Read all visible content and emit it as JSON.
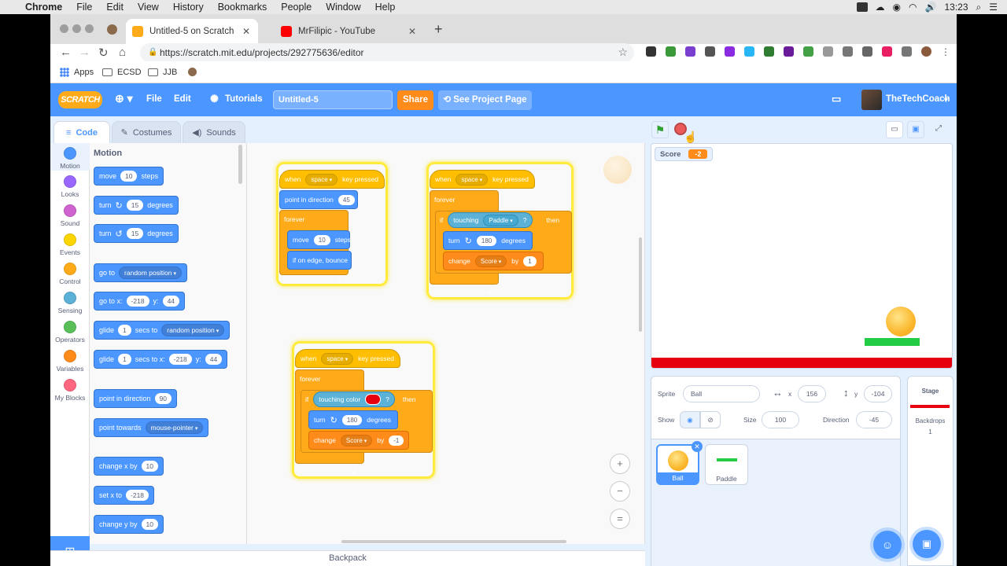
{
  "macos": {
    "app": "Chrome",
    "menu": [
      "File",
      "Edit",
      "View",
      "History",
      "Bookmarks",
      "People",
      "Window",
      "Help"
    ],
    "time": "13:23"
  },
  "browser": {
    "tabs": [
      {
        "title": "Untitled-5 on Scratch",
        "active": true
      },
      {
        "title": "MrFilipic - YouTube",
        "active": false
      }
    ],
    "url": "https://scratch.mit.edu/projects/292775636/editor",
    "bookmarks": [
      "Apps",
      "ECSD",
      "JJB"
    ]
  },
  "scratch": {
    "logo": "SCRATCH",
    "menu": {
      "file": "File",
      "edit": "Edit",
      "tutorials": "Tutorials"
    },
    "project_title": "Untitled-5",
    "share": "Share",
    "see_project": "See Project Page",
    "username": "TheTechCoach",
    "editor_tabs": [
      "Code",
      "Costumes",
      "Sounds"
    ],
    "categories": [
      {
        "label": "Motion",
        "color": "#4c97ff"
      },
      {
        "label": "Looks",
        "color": "#9966ff"
      },
      {
        "label": "Sound",
        "color": "#cf63cf"
      },
      {
        "label": "Events",
        "color": "#ffd500"
      },
      {
        "label": "Control",
        "color": "#ffab19"
      },
      {
        "label": "Sensing",
        "color": "#5cb1d6"
      },
      {
        "label": "Operators",
        "color": "#59c059"
      },
      {
        "label": "Variables",
        "color": "#ff8c1a"
      },
      {
        "label": "My Blocks",
        "color": "#ff6680"
      }
    ],
    "palette": {
      "heading": "Motion",
      "move": {
        "a": "move",
        "n": "10",
        "b": "steps"
      },
      "turn_cw": {
        "a": "turn",
        "n": "15",
        "b": "degrees"
      },
      "turn_ccw": {
        "a": "turn",
        "n": "15",
        "b": "degrees"
      },
      "goto": {
        "a": "go to",
        "d": "random position"
      },
      "gotoxy": {
        "a": "go to x:",
        "x": "-218",
        "b": "y:",
        "y": "44"
      },
      "glide_to": {
        "a": "glide",
        "n": "1",
        "b": "secs to",
        "d": "random position"
      },
      "glide_xy": {
        "a": "glide",
        "n": "1",
        "b": "secs to x:",
        "x": "-218",
        "c": "y:",
        "y": "44"
      },
      "point_dir": {
        "a": "point in direction",
        "n": "90"
      },
      "point_towards": {
        "a": "point towards",
        "d": "mouse-pointer"
      },
      "change_x": {
        "a": "change x by",
        "n": "10"
      },
      "set_x": {
        "a": "set x to",
        "n": "-218"
      },
      "change_y": {
        "a": "change y by",
        "n": "10"
      }
    },
    "scripts": {
      "s1": {
        "when": "when",
        "key": "space",
        "pressed": "key pressed",
        "point": "point in direction",
        "point_n": "45",
        "forever": "forever",
        "move": "move",
        "move_n": "10",
        "steps": "steps",
        "bounce": "if on edge, bounce"
      },
      "s2": {
        "when": "when",
        "key": "space",
        "pressed": "key pressed",
        "forever": "forever",
        "if": "if",
        "touching": "touching",
        "target": "Paddle",
        "q": "?",
        "then": "then",
        "turn": "turn",
        "turn_n": "180",
        "degrees": "degrees",
        "change": "change",
        "var": "Score",
        "by": "by",
        "by_n": "1"
      },
      "s3": {
        "when": "when",
        "key": "space",
        "pressed": "key pressed",
        "forever": "forever",
        "if": "if",
        "touching": "touching color",
        "q": "?",
        "then": "then",
        "turn": "turn",
        "turn_n": "180",
        "degrees": "degrees",
        "change": "change",
        "var": "Score",
        "by": "by",
        "by_n": "-1"
      }
    },
    "backpack": "Backpack",
    "monitor": {
      "label": "Score",
      "value": "-2"
    },
    "sprite": {
      "sprite_label": "Sprite",
      "name": "Ball",
      "x_label": "x",
      "x": "156",
      "y_label": "y",
      "y": "-104",
      "show_label": "Show",
      "size_label": "Size",
      "size": "100",
      "direction_label": "Direction",
      "direction": "-45"
    },
    "sprites": [
      "Ball",
      "Paddle"
    ],
    "stage_pane": {
      "title": "Stage",
      "backdrops_label": "Backdrops",
      "backdrops_count": "1"
    }
  }
}
